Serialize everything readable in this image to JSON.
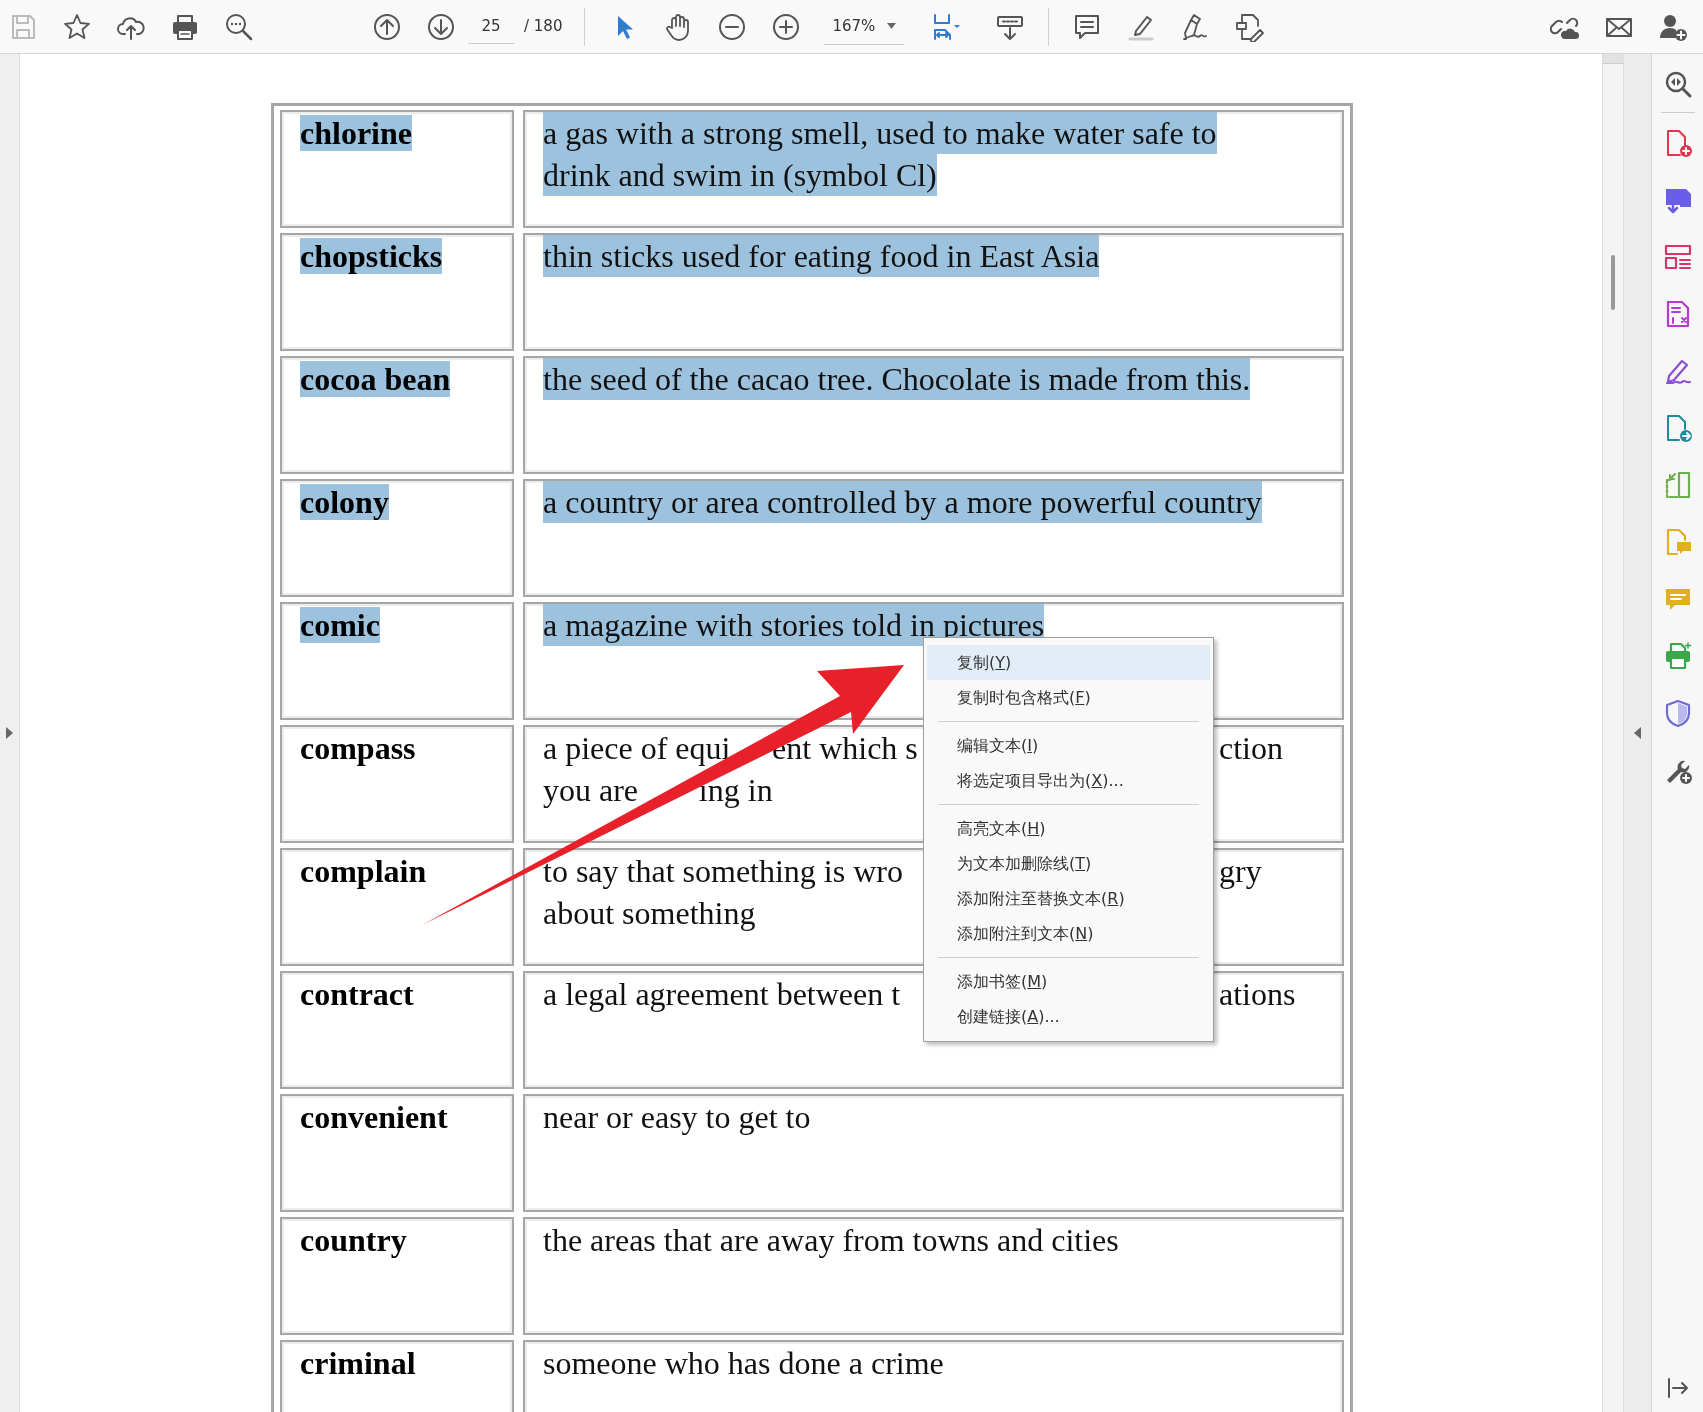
{
  "toolbar": {
    "save": {
      "disabled": true
    },
    "page_number": "25",
    "page_count": "/ 180",
    "tools": [
      {
        "selected": true
      },
      {
        "selected": false
      }
    ],
    "zoom": "167%"
  },
  "rows": [
    {
      "term": "chlorine",
      "selected": true,
      "lines": [
        {
          "parts": [
            "a gas with a strong smell, used to make water safe to"
          ]
        },
        {
          "parts": [
            "drink and swim in (symbol Cl)"
          ]
        }
      ]
    },
    {
      "term": "chopsticks",
      "selected": true,
      "lines": [
        {
          "parts": [
            "thin sticks used for eating food in East Asia"
          ]
        }
      ]
    },
    {
      "term": "cocoa bean",
      "selected": true,
      "lines": [
        {
          "parts": [
            "the seed of the cacao tree. Chocolate is made from this."
          ]
        }
      ]
    },
    {
      "term": "colony",
      "selected": true,
      "lines": [
        {
          "parts": [
            "a country or area controlled by a more powerful country"
          ]
        }
      ]
    },
    {
      "term": "comic",
      "selected": true,
      "lines": [
        {
          "parts": [
            "a magazine with stories told in pictures"
          ]
        }
      ]
    },
    {
      "term": "compass",
      "selected": false,
      "lines": [
        {
          "parts": [
            "a piece of equi",
            "ent which s"
          ],
          "tail": "ction"
        },
        {
          "parts": [
            "you are",
            "ing in"
          ]
        }
      ]
    },
    {
      "term": "complain",
      "selected": false,
      "lines": [
        {
          "parts": [
            "to say that something is wro"
          ],
          "tail": "gry"
        },
        {
          "parts": [
            "about something"
          ]
        }
      ]
    },
    {
      "term": "contract",
      "selected": false,
      "lines": [
        {
          "parts": [
            "a legal agreement between t"
          ],
          "tail": "ations"
        }
      ]
    },
    {
      "term": "convenient",
      "selected": false,
      "lines": [
        {
          "parts": [
            "near or easy to get to"
          ]
        }
      ]
    },
    {
      "term": "country",
      "selected": false,
      "lines": [
        {
          "parts": [
            "the areas that are away from towns and cities"
          ]
        }
      ]
    },
    {
      "term": "criminal",
      "selected": false,
      "lines": [
        {
          "parts": [
            "someone who has done a crime"
          ]
        }
      ]
    }
  ],
  "context_menu": {
    "groups": [
      [
        {
          "before": "复制(",
          "key": "Y",
          "after": ")",
          "selected": true
        },
        {
          "before": "复制时包含格式(",
          "key": "F",
          "after": ")",
          "selected": false
        }
      ],
      [
        {
          "before": "编辑文本(",
          "key": "I",
          "after": ")",
          "selected": false
        },
        {
          "before": "将选定项目导出为(",
          "key": "X",
          "after": ")...",
          "selected": false
        }
      ],
      [
        {
          "before": "高亮文本(",
          "key": "H",
          "after": ")",
          "selected": false
        },
        {
          "before": "为文本加删除线(",
          "key": "T",
          "after": ")",
          "selected": false
        },
        {
          "before": "添加附注至替换文本(",
          "key": "R",
          "after": ")",
          "selected": false
        },
        {
          "before": "添加附注到文本(",
          "key": "N",
          "after": ")",
          "selected": false
        }
      ],
      [
        {
          "before": "添加书签(",
          "key": "M",
          "after": ")",
          "selected": false
        },
        {
          "before": "创建链接(",
          "key": "A",
          "after": ")...",
          "selected": false
        }
      ]
    ]
  }
}
